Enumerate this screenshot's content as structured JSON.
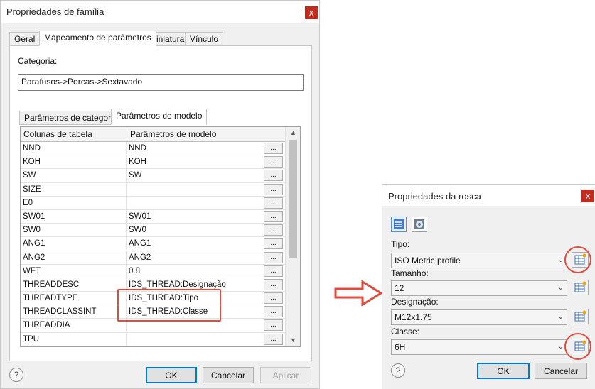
{
  "family_dialog": {
    "title": "Propriedades de família",
    "close_glyph": "x",
    "tabs": [
      "Geral",
      "Mapeamento de parâmetros",
      "Miniatura",
      "Vínculo"
    ],
    "category_label": "Categoria:",
    "category_value": "Parafusos->Porcas->Sextavado",
    "subtabs": [
      "Parâmetros de categoria",
      "Parâmetros de modelo"
    ],
    "grid": {
      "headers": [
        "Colunas de tabela",
        "Parâmetros de modelo"
      ],
      "button_label": "...",
      "rows": [
        [
          "NND",
          "NND"
        ],
        [
          "KOH",
          "KOH"
        ],
        [
          "SW",
          "SW"
        ],
        [
          "SIZE",
          ""
        ],
        [
          "E0",
          ""
        ],
        [
          "SW01",
          "SW01"
        ],
        [
          "SW0",
          "SW0"
        ],
        [
          "ANG1",
          "ANG1"
        ],
        [
          "ANG2",
          "ANG2"
        ],
        [
          "WFT",
          "0.8"
        ],
        [
          "THREADDESC",
          "IDS_THREAD:Designação"
        ],
        [
          "THREADTYPE",
          "IDS_THREAD:Tipo"
        ],
        [
          "THREADCLASSINT",
          "IDS_THREAD:Classe"
        ],
        [
          "THREADDIA",
          ""
        ],
        [
          "TPU",
          ""
        ]
      ],
      "scroll_up": "▲",
      "scroll_down": "▼"
    },
    "help_glyph": "?",
    "buttons": {
      "ok": "OK",
      "cancel": "Cancelar",
      "apply": "Aplicar"
    }
  },
  "thread_dialog": {
    "title": "Propriedades da rosca",
    "close_glyph": "x",
    "tipo_label": "Tipo:",
    "tipo_value": "ISO Metric profile",
    "tamanho_label": "Tamanho:",
    "tamanho_value": "12",
    "designacao_label": "Designação:",
    "designacao_value": "M12x1.75",
    "classe_label": "Classe:",
    "classe_value": "6H",
    "chevron": "⌄",
    "help_glyph": "?",
    "buttons": {
      "ok": "OK",
      "cancel": "Cancelar"
    }
  },
  "colors": {
    "highlight": "#e24a3b",
    "accent": "#0078d7",
    "close": "#c42b1c"
  }
}
